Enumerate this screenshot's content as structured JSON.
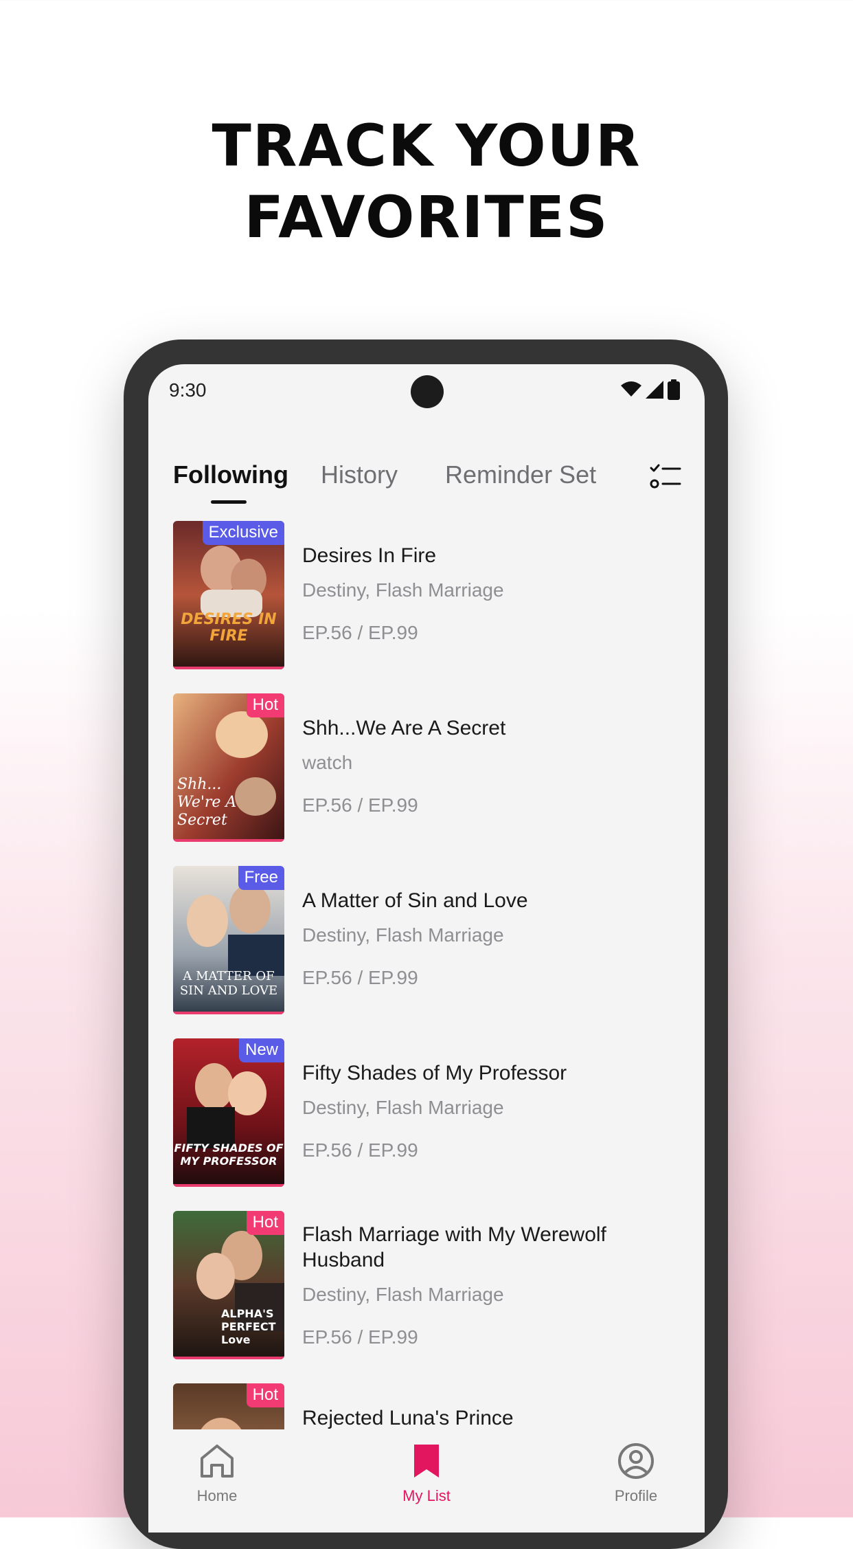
{
  "headline": {
    "line1": "TRACK YOUR",
    "line2": "FAVORITES"
  },
  "status_bar": {
    "time": "9:30",
    "icons": [
      "wifi-icon",
      "signal-icon",
      "battery-icon"
    ]
  },
  "tabs": [
    {
      "label": "Following",
      "active": true
    },
    {
      "label": "History",
      "active": false
    },
    {
      "label": "Reminder Set",
      "active": false
    }
  ],
  "filter_icon": "checklist-icon",
  "items": [
    {
      "title": "Desires In Fire",
      "tags": "Destiny, Flash Marriage",
      "episodes": "EP.56 / EP.99",
      "badge": "Exclusive",
      "badge_color": "#5a5be6",
      "cover_text": "DESIRES IN FIRE"
    },
    {
      "title": "Shh...We Are A Secret",
      "tags": "watch",
      "episodes": "EP.56 / EP.99",
      "badge": "Hot",
      "badge_color": "#f23a73",
      "cover_text": "Shh... We're A Secret"
    },
    {
      "title": "A Matter of Sin and Love",
      "tags": "Destiny, Flash Marriage",
      "episodes": "EP.56 / EP.99",
      "badge": "Free",
      "badge_color": "#5a5be6",
      "cover_text": "A MATTER OF SIN AND LOVE"
    },
    {
      "title": "Fifty Shades of My Professor",
      "tags": "Destiny, Flash Marriage",
      "episodes": "EP.56 / EP.99",
      "badge": "New",
      "badge_color": "#5a5be6",
      "cover_text": "FIFTY SHADES OF MY PROFESSOR"
    },
    {
      "title": "Flash Marriage with My Werewolf Husband",
      "tags": "Destiny, Flash Marriage",
      "episodes": "EP.56 / EP.99",
      "badge": "Hot",
      "badge_color": "#f23a73",
      "cover_text": "ALPHA'S PERFECT Love"
    },
    {
      "title": "Rejected Luna's Prince",
      "tags": "",
      "episodes": "",
      "badge": "Hot",
      "badge_color": "#f23a73",
      "cover_text": ""
    }
  ],
  "nav": [
    {
      "label": "Home",
      "icon": "home-icon",
      "active": false
    },
    {
      "label": "My List",
      "icon": "bookmark-icon",
      "active": true
    },
    {
      "label": "Profile",
      "icon": "profile-icon",
      "active": false
    }
  ],
  "colors": {
    "accent": "#e2155f",
    "badge_blue": "#5a5be6",
    "badge_pink": "#f23a73"
  }
}
